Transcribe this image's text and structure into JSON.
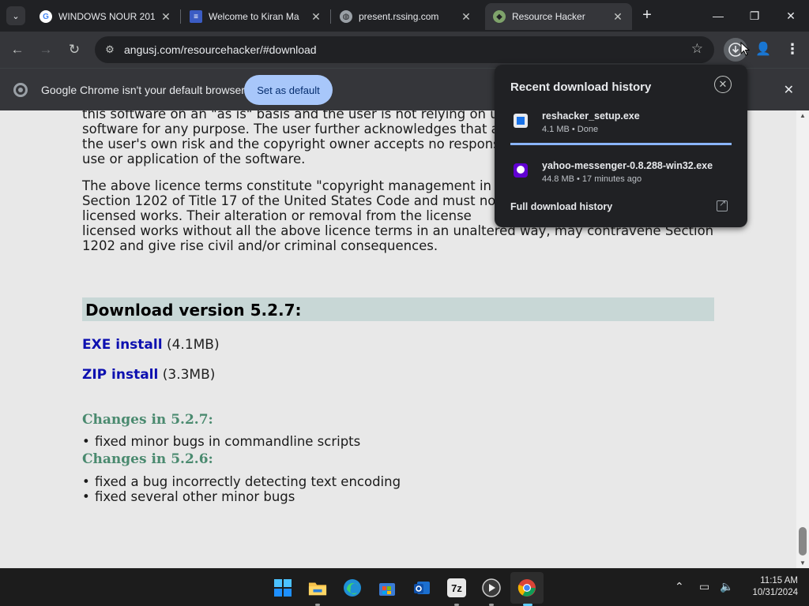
{
  "tabs": [
    {
      "title": "WINDOWS NOUR 201",
      "favicon": "google-icon"
    },
    {
      "title": "Welcome to Kiran Ma",
      "favicon": "flag-icon"
    },
    {
      "title": "present.rssing.com",
      "favicon": "globe-icon"
    },
    {
      "title": "Resource Hacker",
      "favicon": "resource-hacker-icon",
      "active": true
    }
  ],
  "toolbar": {
    "url": "angusj.com/resourcehacker/#download"
  },
  "infobar": {
    "message": "Google Chrome isn't your default browser",
    "button": "Set as default"
  },
  "page": {
    "para1": "this software on an \"as is\" basis and the user is not relying on it for any purpose. The user further acknowledges that all use of the software is at the user's own risk and the copyright owner accepts no responsibility for any loss or damage resulting from the use or application of the software.",
    "para1_lines": [
      "this software on an \"as is\" basis and the user is not relying on u",
      "software for any purpose. The user further acknowledges that a",
      "the user's own risk and the copyright owner accepts no respons",
      "use or application of the software."
    ],
    "para2_lines": [
      "The above licence terms constitute \"copyright management in",
      "Section 1202 of Title 17 of the United States Code and must no",
      "licensed works. Their alteration or removal from the license",
      "licensed works without all the above licence terms in an unaltered way, may contravene Section",
      "1202 and give rise civil and/or criminal consequences."
    ],
    "download_heading": "Download version 5.2.7:",
    "exe_link": "EXE install",
    "exe_size": "(4.1MB)",
    "zip_link": "ZIP install",
    "zip_size": "(3.3MB)",
    "changes_527": "Changes in 5.2.7:",
    "changes_527_items": [
      "fixed minor bugs in commandline scripts"
    ],
    "changes_526": "Changes in 5.2.6:",
    "changes_526_items": [
      "fixed a bug incorrectly detecting text encoding",
      "fixed several other minor bugs"
    ]
  },
  "downloads": {
    "title": "Recent download history",
    "items": [
      {
        "name": "reshacker_setup.exe",
        "meta": "4.1 MB • Done"
      },
      {
        "name": "yahoo-messenger-0.8.288-win32.exe",
        "meta": "44.8 MB • 17 minutes ago"
      }
    ],
    "full_history": "Full download history"
  },
  "taskbar": {
    "time": "11:15 AM",
    "date": "10/31/2024",
    "apps": [
      "windows-start-icon",
      "file-explorer-icon",
      "edge-icon",
      "store-icon",
      "outlook-icon",
      "7zip-icon",
      "media-player-icon",
      "chrome-icon"
    ],
    "seven_zip_label": "7z"
  },
  "colors": {
    "accent": "#a8c7fa",
    "link": "#0d10b0",
    "changes_heading": "#4a8a6f",
    "download_heading_bg": "#c8d7d6"
  }
}
